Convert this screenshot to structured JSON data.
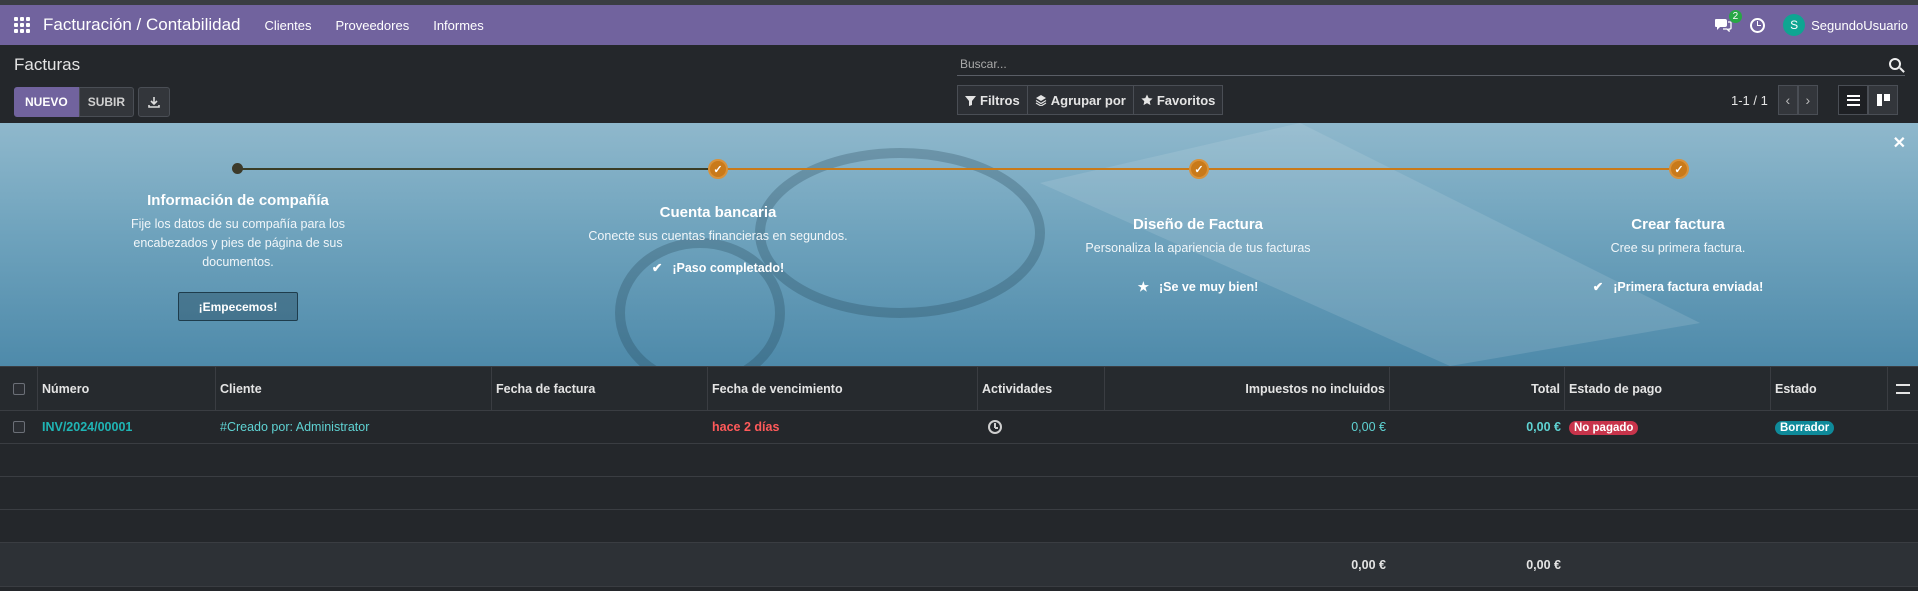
{
  "navbar": {
    "brand": "Facturación / Contabilidad",
    "menu": [
      "Clientes",
      "Proveedores",
      "Informes"
    ],
    "chat_badge": "2",
    "user_initial": "S",
    "user_name": "SegundoUsuario",
    "color": "#71639e"
  },
  "control": {
    "title": "Facturas",
    "new_label": "NUEVO",
    "upload_label": "SUBIR",
    "search_placeholder": "Buscar...",
    "filters_label": "Filtros",
    "group_label": "Agrupar por",
    "favorites_label": "Favoritos",
    "pager_value": "1-1 / 1"
  },
  "onboarding": {
    "steps": [
      {
        "title": "Información de compañía",
        "description": "Fije los datos de su compañía para los encabezados y pies de página de sus documentos.",
        "button": "¡Empecemos!",
        "state": "current"
      },
      {
        "title": "Cuenta bancaria",
        "description": "Conecte sus cuentas financieras en segundos.",
        "status": "¡Paso completado!",
        "status_icon": "check-icon",
        "state": "done"
      },
      {
        "title": "Diseño de Factura",
        "description": "Personaliza la apariencia de tus facturas",
        "status": "¡Se ve muy bien!",
        "status_icon": "star-icon",
        "state": "done"
      },
      {
        "title": "Crear factura",
        "description": "Cree su primera factura.",
        "status": "¡Primera factura enviada!",
        "status_icon": "check-icon",
        "state": "done"
      }
    ]
  },
  "table": {
    "headers": {
      "number": "Número",
      "client": "Cliente",
      "invoice_date": "Fecha de factura",
      "due_date": "Fecha de vencimiento",
      "activities": "Actividades",
      "untaxed": "Impuestos no incluidos",
      "total": "Total",
      "payment_state": "Estado de pago",
      "state": "Estado"
    },
    "rows": [
      {
        "number": "INV/2024/00001",
        "client": "#Creado por: Administrator",
        "invoice_date": "",
        "due_date": "hace 2 días",
        "untaxed": "0,00 €",
        "total": "0,00 €",
        "payment_state": "No pagado",
        "state": "Borrador"
      }
    ],
    "footer": {
      "untaxed": "0,00 €",
      "total": "0,00 €"
    }
  }
}
